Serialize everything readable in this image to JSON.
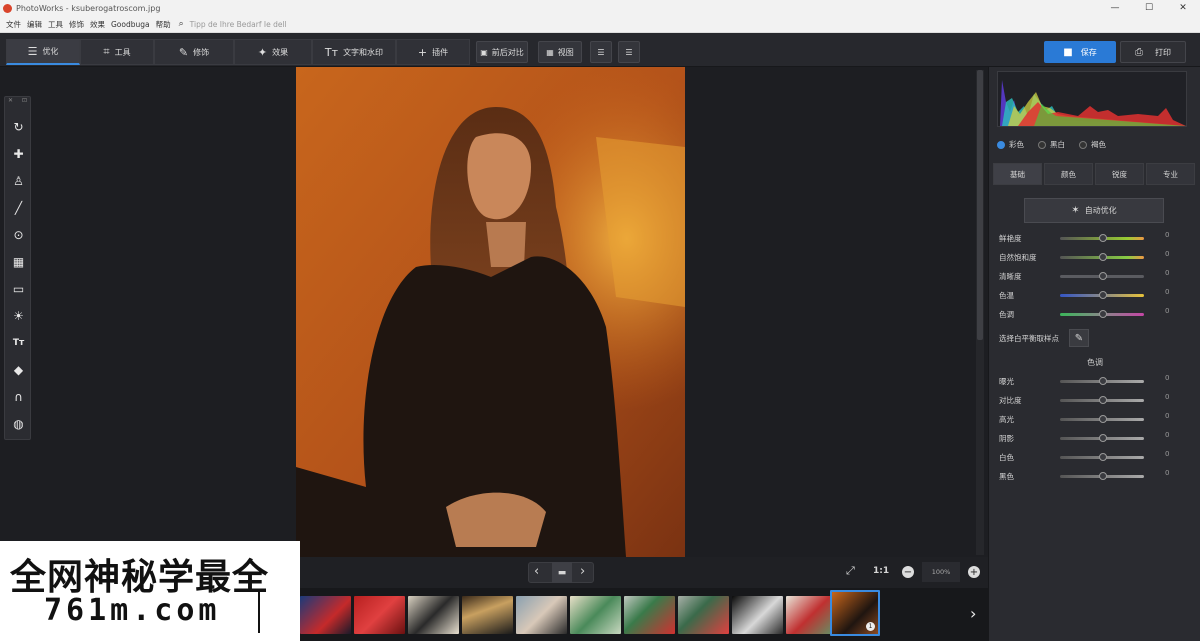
{
  "window": {
    "title": "PhotoWorks - ksuberogatroscom.jpg",
    "min": "—",
    "max": "☐",
    "close": "✕"
  },
  "menu": [
    "文件",
    "编辑",
    "工具",
    "修饰",
    "效果",
    "Goodbuga",
    "帮助"
  ],
  "menu_hint": "Tipp de Ihre Bedarf Ie dell",
  "tabs": [
    {
      "icon": "☰",
      "label": "优化"
    },
    {
      "icon": "⌗",
      "label": "工具"
    },
    {
      "icon": "✎",
      "label": "修饰"
    },
    {
      "icon": "✦",
      "label": "效果"
    },
    {
      "icon": "Tт",
      "label": "文字和水印"
    },
    {
      "icon": "+",
      "label": "插件"
    }
  ],
  "toolbar_buttons": {
    "compare": "前后对比",
    "view": "视图"
  },
  "save_label": "保存",
  "print_label": "打印",
  "tool_header": [
    "✕",
    "⊡"
  ],
  "left_tools": [
    {
      "icon": "rotate-icon",
      "glyph": "↻"
    },
    {
      "icon": "healing-icon",
      "glyph": "✚"
    },
    {
      "icon": "stamp-icon",
      "glyph": "♙"
    },
    {
      "icon": "brush-icon",
      "glyph": "╱"
    },
    {
      "icon": "target-icon",
      "glyph": "⊙"
    },
    {
      "icon": "gradient-icon",
      "glyph": "▦"
    },
    {
      "icon": "vignette-icon",
      "glyph": "▭"
    },
    {
      "icon": "light-icon",
      "glyph": "☀"
    },
    {
      "icon": "text-icon",
      "glyph": "Tт"
    },
    {
      "icon": "bucket-icon",
      "glyph": "◆"
    },
    {
      "icon": "magnet-icon",
      "glyph": "∩"
    },
    {
      "icon": "globe-icon",
      "glyph": "◍"
    }
  ],
  "nav": {
    "prev": "‹",
    "folder": "▬",
    "next": "›",
    "fit": "⤢",
    "one_to_one": "1:1",
    "zoom_out": "−",
    "zoom_value": "100%",
    "zoom_in": "+",
    "film_next": "›"
  },
  "thumbnail_count": 11,
  "selected_thumbnail": "1",
  "radios": [
    {
      "label": "彩色",
      "on": true
    },
    {
      "label": "黑白",
      "on": false
    },
    {
      "label": "褐色",
      "on": false
    }
  ],
  "panel_tabs": [
    "基础",
    "颜色",
    "锐度",
    "专业"
  ],
  "auto_button": "自动优化",
  "basic_sliders": [
    {
      "label": "鲜艳度",
      "value": "0",
      "grad": "linear-gradient(90deg,#555,#9c3 80%,#e94)"
    },
    {
      "label": "自然饱和度",
      "value": "0",
      "grad": "linear-gradient(90deg,#555,#8c4 80%,#e94)"
    },
    {
      "label": "清晰度",
      "value": "0",
      "grad": "#5a5b60"
    },
    {
      "label": "色温",
      "value": "0",
      "grad": "linear-gradient(90deg,#3456c6,#888 50%,#e8c33a)"
    },
    {
      "label": "色调",
      "value": "0",
      "grad": "linear-gradient(90deg,#3bb55a,#888 50%,#c546a6)"
    }
  ],
  "white_balance_label": "选择白平衡取样点",
  "tone_section": "色调",
  "tone_sliders": [
    {
      "label": "曝光",
      "value": "0"
    },
    {
      "label": "对比度",
      "value": "0"
    },
    {
      "label": "高光",
      "value": "0"
    },
    {
      "label": "阴影",
      "value": "0"
    },
    {
      "label": "白色",
      "value": "0"
    },
    {
      "label": "黑色",
      "value": "0"
    }
  ],
  "watermark": {
    "line1": "全网神秘学最全",
    "line2": "761m.com"
  }
}
